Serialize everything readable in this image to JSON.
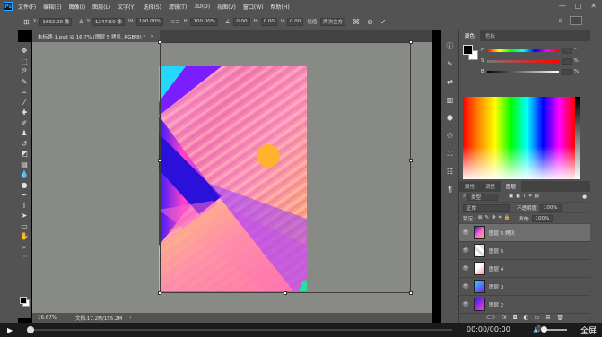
{
  "menubar": {
    "logo": "Ps",
    "items": [
      "文件(F)",
      "编辑(E)",
      "图像(I)",
      "图层(L)",
      "文字(Y)",
      "选择(S)",
      "滤镜(T)",
      "3D(D)",
      "视图(V)",
      "窗口(W)",
      "帮助(H)"
    ],
    "controls": [
      "—",
      "□",
      "✕"
    ]
  },
  "options": {
    "x_label": "X:",
    "x_value": "1692.00 像",
    "y_label": "Y:",
    "y_value": "1247.50 像",
    "w_label": "W:",
    "w_value": "100.00%",
    "h_label": "H:",
    "h_value": "100.00%",
    "angle_value": "0.00",
    "hskew_label": "H:",
    "hskew_value": "0.00",
    "vskew_label": "V:",
    "vskew_value": "0.00",
    "interp_label": "插值:",
    "interp_value": "两次立方"
  },
  "document": {
    "tab_title": "未标题-1.psd @ 16.7% (图层 5 拷贝, RGB/8) *",
    "close": "×"
  },
  "status": {
    "zoom": "16.67%",
    "doc_size": "文档:17.2M/155.2M"
  },
  "color_panel": {
    "tabs": [
      "颜色",
      "色板"
    ],
    "sliders": [
      {
        "label": "H",
        "unit": "°"
      },
      {
        "label": "S",
        "unit": "%"
      },
      {
        "label": "B",
        "unit": "%"
      }
    ]
  },
  "layers_panel": {
    "tabs": [
      "属性",
      "调整",
      "图层"
    ],
    "filter": "类型",
    "blend_mode": "正常",
    "opacity_label": "不透明度:",
    "opacity_value": "100%",
    "lock_label": "锁定:",
    "fill_label": "填充:",
    "fill_value": "100%",
    "layers": [
      {
        "name": "图层 5 拷贝",
        "selected": true
      },
      {
        "name": "图层 5",
        "selected": false
      },
      {
        "name": "图层 4",
        "selected": false
      },
      {
        "name": "图层 3",
        "selected": false
      },
      {
        "name": "图层 2",
        "selected": false
      }
    ]
  },
  "player": {
    "time": "00:00/00:00",
    "fullscreen": "全屏"
  }
}
